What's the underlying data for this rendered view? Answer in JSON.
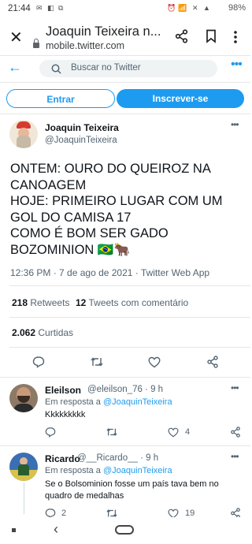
{
  "status": {
    "time": "21:44",
    "battery": "98%"
  },
  "browser": {
    "title": "Joaquin Teixeira n...",
    "url": "mobile.twitter.com"
  },
  "header": {
    "search_placeholder": "Buscar no Twitter"
  },
  "auth": {
    "login_label": "Entrar",
    "signup_label": "Inscrever-se"
  },
  "tweet": {
    "author_name": "Joaquin Teixeira",
    "author_handle": "@JoaquinTeixeira",
    "text": "ONTEM: OURO DO QUEIROZ NA CANOAGEM\nHOJE: PRIMEIRO LUGAR COM UM GOL DO CAMISA 17\nCOMO É BOM SER GADO BOZOMINION 🇧🇷🐂",
    "timestamp": "12:36 PM · 7 de ago de 2021 · Twitter Web App",
    "retweets_count": "218",
    "retweets_label": "Retweets",
    "quotes_count": "12",
    "quotes_label": "Tweets com comentário",
    "likes_count": "2.062",
    "likes_label": "Curtidas"
  },
  "replies": [
    {
      "name": "Eleilson",
      "handle_time": "@eleilson_76 · 9 h",
      "reply_prefix": "Em resposta a",
      "reply_to": "@JoaquinTeixeira",
      "text": "Kkkkkkkkk",
      "likes": "4",
      "replies": "",
      "avatar_color": "#7a6a5a"
    },
    {
      "name": "Ricardo",
      "handle_time": "@__Ricardo__ · 9 h",
      "reply_prefix": "Em resposta a",
      "reply_to": "@JoaquinTeixeira",
      "text": "Se o Bolsominion fosse um país tava bem no quadro de medalhas",
      "likes": "19",
      "replies": "2",
      "avatar_color": "#3b6fb3"
    }
  ],
  "colors": {
    "accent": "#1d9bf0",
    "text": "#0f1419",
    "muted": "#536471"
  }
}
